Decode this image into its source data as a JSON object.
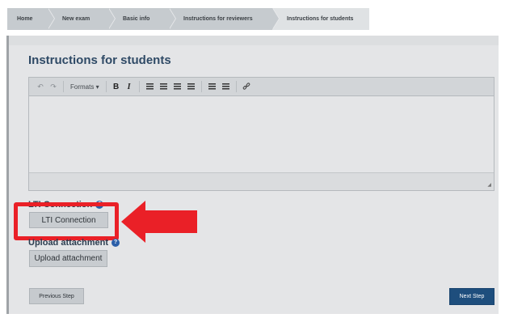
{
  "breadcrumb": {
    "items": [
      {
        "label": "Home"
      },
      {
        "label": "New exam"
      },
      {
        "label": "Basic info"
      },
      {
        "label": "Instructions for reviewers"
      },
      {
        "label": "Instructions for students"
      }
    ]
  },
  "page": {
    "title": "Instructions for students"
  },
  "editor": {
    "toolbar": {
      "undo_icon": "undo-icon",
      "redo_icon": "redo-icon",
      "formats_label": "Formats",
      "bold_label": "B",
      "italic_label": "I",
      "link_icon": "link-icon"
    },
    "content": ""
  },
  "lti": {
    "label": "LTI Connection",
    "button_label": "LTI Connection",
    "help_icon": "?"
  },
  "upload": {
    "label": "Upload attachment",
    "button_label": "Upload attachment",
    "help_icon": "?"
  },
  "footer": {
    "previous_label": "Previous Step",
    "next_label": "Next Step"
  },
  "colors": {
    "highlight": "#ea2027",
    "primary": "#1e4e7d",
    "title": "#2f4a66"
  }
}
